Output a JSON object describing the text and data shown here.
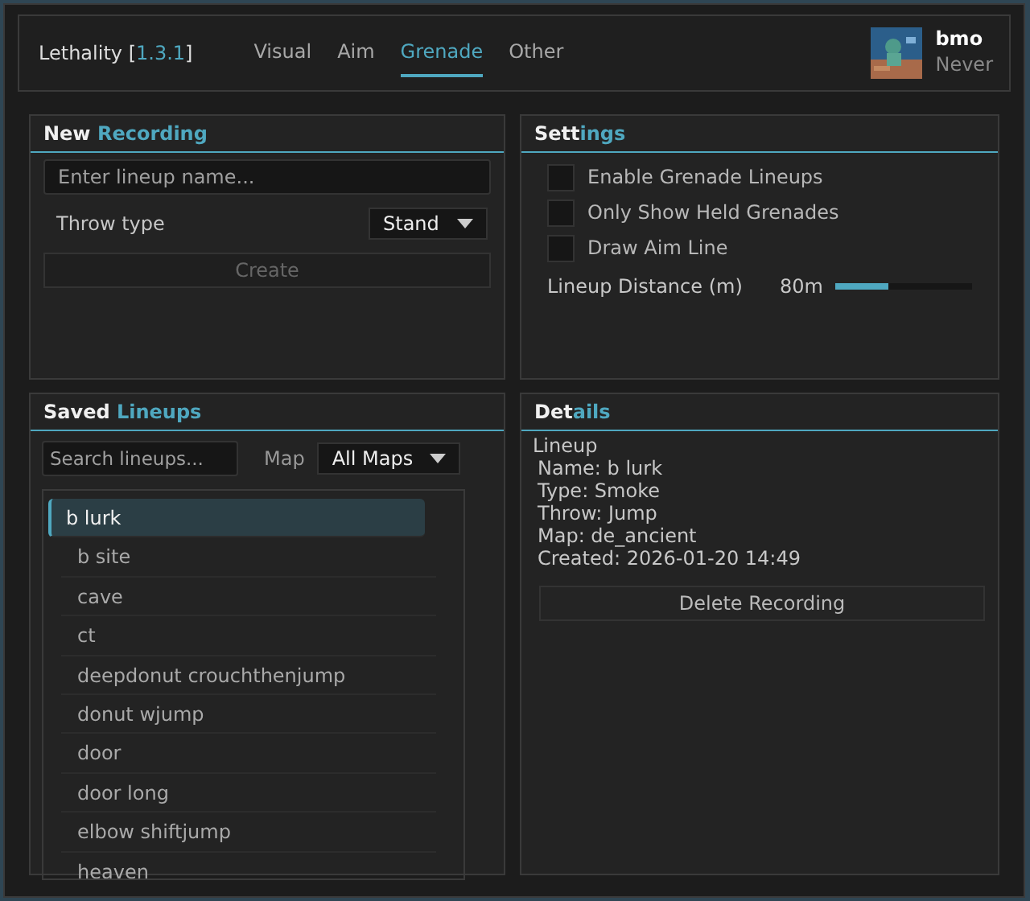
{
  "header": {
    "app_name": "Lethality",
    "version_open": "[",
    "version": "1.3.1",
    "version_close": "]",
    "tabs": [
      {
        "label": "Visual",
        "selected": false
      },
      {
        "label": "Aim",
        "selected": false
      },
      {
        "label": "Grenade",
        "selected": true
      },
      {
        "label": "Other",
        "selected": false
      }
    ],
    "user": {
      "name": "bmo",
      "subtitle": "Never"
    }
  },
  "new_recording": {
    "title": {
      "lead": "New ",
      "rest": "Recording"
    },
    "name_field": {
      "placeholder": "Enter lineup name..."
    },
    "throw_type": {
      "label": "Throw type",
      "value": "Stand"
    },
    "create_button": {
      "label": "Create",
      "disabled": true
    }
  },
  "settings": {
    "title": {
      "lead": "Sett",
      "rest": "ings"
    },
    "options": [
      {
        "label": "Enable Grenade Lineups",
        "checked": false
      },
      {
        "label": "Only Show Held Grenades",
        "checked": false
      },
      {
        "label": "Draw Aim Line",
        "checked": false
      }
    ],
    "distance": {
      "label": "Lineup Distance (m)",
      "reading": "80m",
      "level": 0.38
    }
  },
  "saved_lineups": {
    "title": {
      "lead": "Saved ",
      "rest": "Lineups"
    },
    "search": {
      "placeholder": "Search lineups..."
    },
    "map_filter": {
      "label": "Map",
      "value": "All Maps"
    },
    "items": [
      {
        "label": "b lurk",
        "selected": true
      },
      {
        "label": "b site",
        "selected": false
      },
      {
        "label": "cave",
        "selected": false
      },
      {
        "label": "ct",
        "selected": false
      },
      {
        "label": "deepdonut crouchthenjump",
        "selected": false
      },
      {
        "label": "donut wjump",
        "selected": false
      },
      {
        "label": "door",
        "selected": false
      },
      {
        "label": "door long",
        "selected": false
      },
      {
        "label": "elbow shiftjump",
        "selected": false
      },
      {
        "label": "heaven",
        "selected": false
      }
    ]
  },
  "details": {
    "title": {
      "lead": "Det",
      "rest": "ails"
    },
    "heading": "Lineup",
    "lines": [
      "Name: b lurk",
      "Type: Smoke",
      "Throw: Jump",
      "Map: de_ancient",
      "Created: 2026-01-20 14:49"
    ],
    "delete_button": {
      "label": "Delete Recording"
    }
  }
}
